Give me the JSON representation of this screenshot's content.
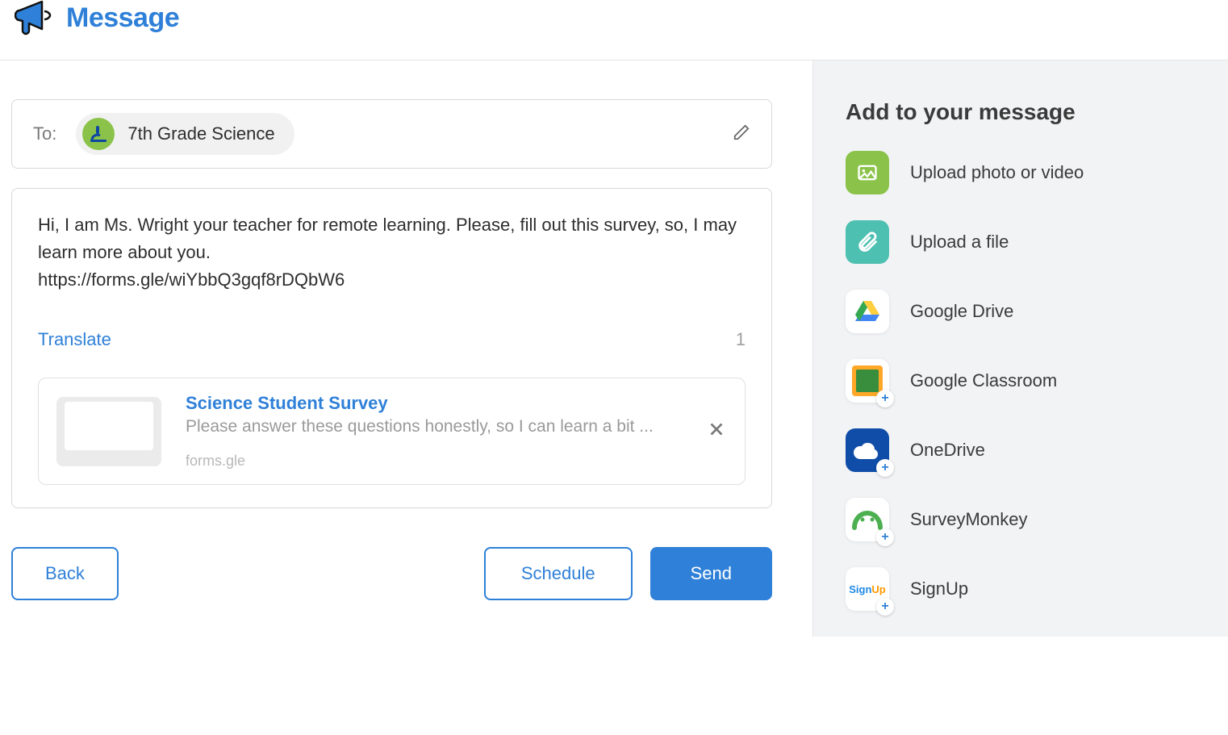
{
  "header": {
    "title": "Message"
  },
  "composer": {
    "to_label": "To:",
    "recipient": "7th Grade Science",
    "body": "Hi, I am Ms. Wright your teacher for remote learning. Please, fill out this survey, so, I may learn more about you.\nhttps://forms.gle/wiYbbQ3gqf8rDQbW6",
    "translate_label": "Translate",
    "count": "1",
    "link_preview": {
      "title": "Science Student Survey",
      "description": "Please answer these questions honestly, so I can learn a bit ...",
      "domain": "forms.gle"
    }
  },
  "actions": {
    "back": "Back",
    "schedule": "Schedule",
    "send": "Send"
  },
  "sidebar": {
    "title": "Add to your message",
    "items": [
      {
        "label": "Upload photo or video"
      },
      {
        "label": "Upload a file"
      },
      {
        "label": "Google Drive"
      },
      {
        "label": "Google Classroom"
      },
      {
        "label": "OneDrive"
      },
      {
        "label": "SurveyMonkey"
      },
      {
        "label": "SignUp"
      }
    ]
  }
}
